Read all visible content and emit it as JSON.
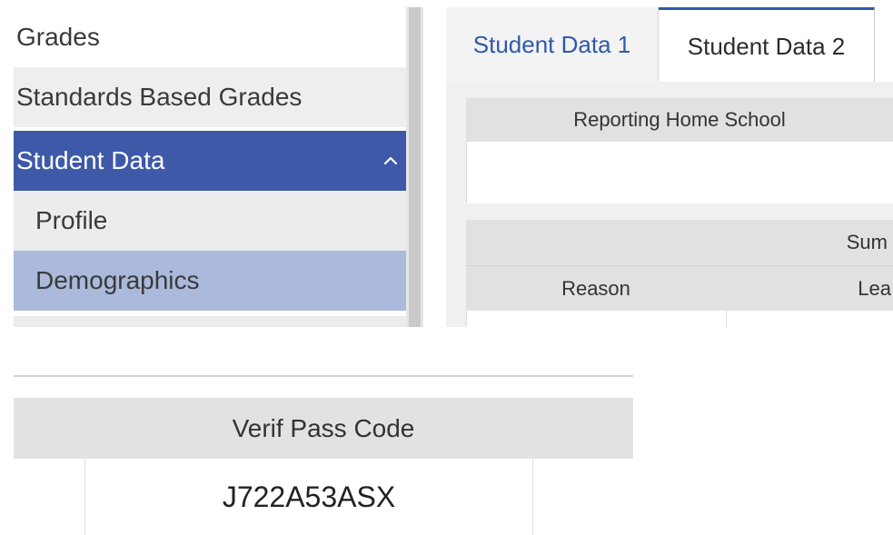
{
  "sidebar": {
    "items": [
      {
        "label": "Grades"
      },
      {
        "label": "Standards Based Grades"
      },
      {
        "label": "Student Data"
      },
      {
        "label": "Profile"
      },
      {
        "label": "Demographics"
      }
    ]
  },
  "tabs": [
    {
      "label": "Student Data 1"
    },
    {
      "label": "Student Data 2"
    }
  ],
  "panel": {
    "reporting_home_school_header": "Reporting Home School",
    "summary_header_partial": "Sum",
    "reason_header": "Reason",
    "lea_header_partial": "Lea"
  },
  "verification": {
    "header": "Verif Pass Code",
    "value": "J722A53ASX"
  },
  "colors": {
    "active_nav": "#3d59a8",
    "selected_sub": "#aab9dc",
    "tab_accent": "#2e5aa8"
  },
  "icons": {
    "chevron": "chevron-up-icon"
  }
}
